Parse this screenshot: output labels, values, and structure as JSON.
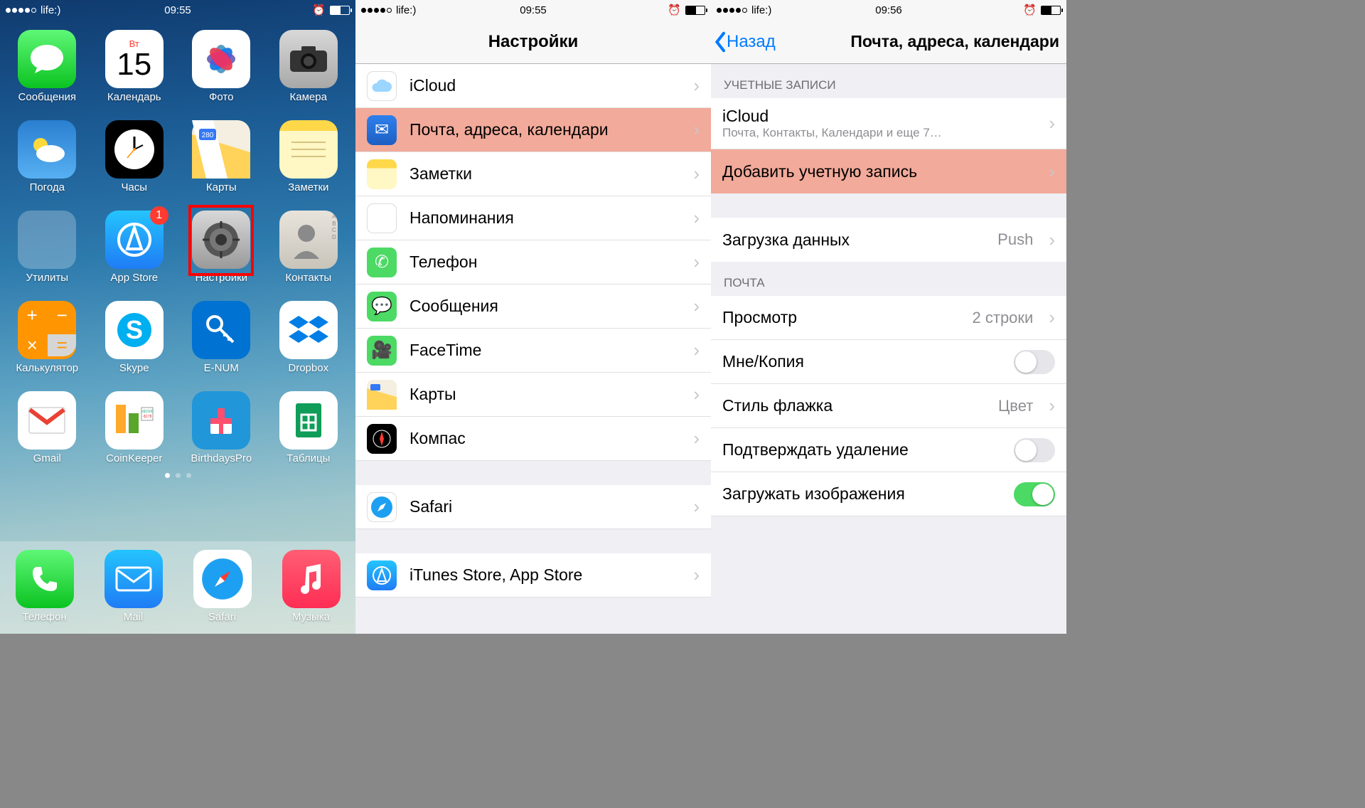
{
  "status": {
    "carrier": "life:)",
    "time1": "09:55",
    "time2": "09:55",
    "time3": "09:56"
  },
  "home": {
    "calendar_weekday": "Вт",
    "calendar_day": "15",
    "apps": {
      "messages": "Сообщения",
      "calendar": "Календарь",
      "photos": "Фото",
      "camera": "Камера",
      "weather": "Погода",
      "clock": "Часы",
      "maps": "Карты",
      "notes": "Заметки",
      "utilities": "Утилиты",
      "appstore": "App Store",
      "settings": "Настройки",
      "contacts": "Контакты",
      "calculator": "Калькулятор",
      "skype": "Skype",
      "enum": "E-NUM",
      "dropbox": "Dropbox",
      "gmail": "Gmail",
      "coinkeeper": "CoinKeeper",
      "birthdays": "BirthdaysPro",
      "tables": "Таблицы"
    },
    "badge_appstore": "1",
    "dock": {
      "phone": "Телефон",
      "mail": "Mail",
      "safari": "Safari",
      "music": "Музыка"
    }
  },
  "settings": {
    "title": "Настройки",
    "rows": {
      "icloud": "iCloud",
      "mail": "Почта, адреса, календари",
      "notes": "Заметки",
      "reminders": "Напоминания",
      "phone": "Телефон",
      "messages": "Сообщения",
      "facetime": "FaceTime",
      "maps": "Карты",
      "compass": "Компас",
      "safari": "Safari",
      "itunes": "iTunes Store, App Store"
    }
  },
  "mail": {
    "back": "Назад",
    "title": "Почта, адреса, календари",
    "sec_accounts": "УЧЕТНЫЕ ЗАПИСИ",
    "icloud": "iCloud",
    "icloud_sub": "Почта, Контакты, Календари и еще 7…",
    "add_account": "Добавить учетную запись",
    "fetch": "Загрузка данных",
    "fetch_value": "Push",
    "sec_mail": "ПОЧТА",
    "preview": "Просмотр",
    "preview_value": "2 строки",
    "cc": "Мне/Копия",
    "flag": "Стиль флажка",
    "flag_value": "Цвет",
    "confirm": "Подтверждать удаление",
    "images": "Загружать изображения"
  }
}
